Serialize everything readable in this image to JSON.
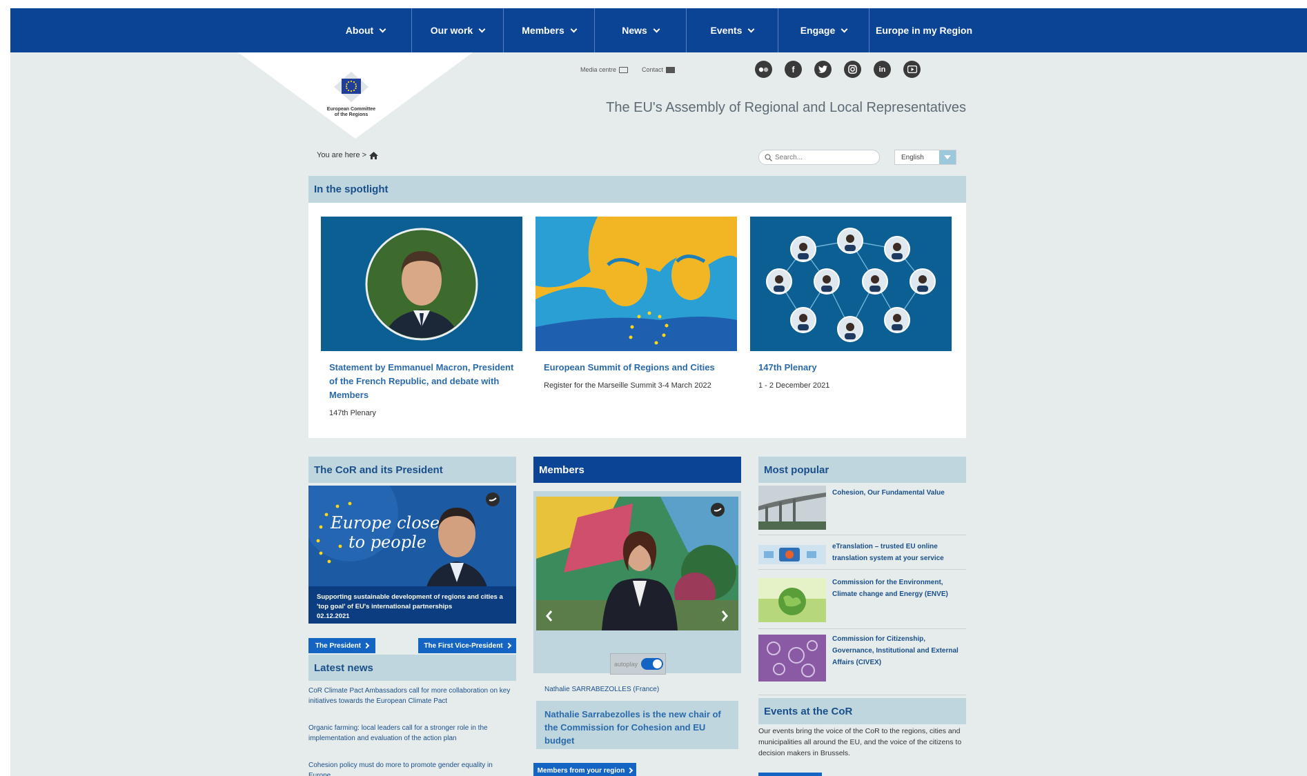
{
  "nav": {
    "items": [
      {
        "label": "About",
        "w": 134
      },
      {
        "label": "Our work",
        "w": 133
      },
      {
        "label": "Members",
        "w": 132
      },
      {
        "label": "News",
        "w": 133
      },
      {
        "label": "Events",
        "w": 133
      },
      {
        "label": "Engage",
        "w": 132
      },
      {
        "label": "Europe in my Region",
        "w": 158
      }
    ]
  },
  "logo": {
    "line1": "European Committee",
    "line2": "of the Regions"
  },
  "util": {
    "media": "Media centre",
    "contact": "Contact"
  },
  "social": [
    "flickr-icon",
    "facebook-icon",
    "twitter-icon",
    "instagram-icon",
    "linkedin-icon",
    "youtube-icon"
  ],
  "tagline": "The EU's Assembly of Regional and Local Representatives",
  "breadcrumb": {
    "label": "You are here >"
  },
  "search": {
    "placeholder": "Search..."
  },
  "language": {
    "selected": "English"
  },
  "spotlight": {
    "heading": "In the spotlight",
    "cards": [
      {
        "title": "Statement by Emmanuel Macron, President of the French Republic, and debate with Members",
        "sub": "147th Plenary"
      },
      {
        "title": "European Summit of Regions and Cities",
        "sub": "Register for the Marseille Summit 3-4 March 2022"
      },
      {
        "title": "147th Plenary",
        "sub": "1 - 2 December 2021"
      }
    ]
  },
  "cor": {
    "heading": "The CoR and its President",
    "script_line1": "Europe closer",
    "script_line2": "to people",
    "caption": "Supporting sustainable development of regions and cities a 'top goal' of EU's international partnerships",
    "date": "02.12.2021",
    "btn_president": "The President",
    "btn_vice": "The First Vice-President"
  },
  "latest_news": {
    "heading": "Latest news",
    "items": [
      "CoR Climate Pact Ambassadors call for more collaboration on key initiatives towards the European Climate Pact",
      "Organic farming: local leaders call for a stronger role in the implementation and evaluation of the action plan",
      "Cohesion policy must do more to promote gender equality in Europe"
    ]
  },
  "members": {
    "heading": "Members",
    "autoplay": "autoplay",
    "name": "Nathalie SARRABEZOLLES (France)",
    "title": "Nathalie Sarrabezolles is the new chair of the Commission for Cohesion and EU budget",
    "btn": "Members from your region"
  },
  "popular": {
    "heading": "Most popular",
    "items": [
      "Cohesion, Our Fundamental Value",
      "eTranslation – trusted EU online translation system at your service",
      "Commission for the Environment, Climate change and Energy (ENVE)",
      "Commission for Citizenship, Governance, Institutional and External Affairs (CIVEX)"
    ]
  },
  "events": {
    "heading": "Events at the CoR",
    "desc": "Our events bring the voice of the CoR to the regions, cities and municipalities all around the EU, and the voice of the citizens to decision makers in Brussels."
  }
}
